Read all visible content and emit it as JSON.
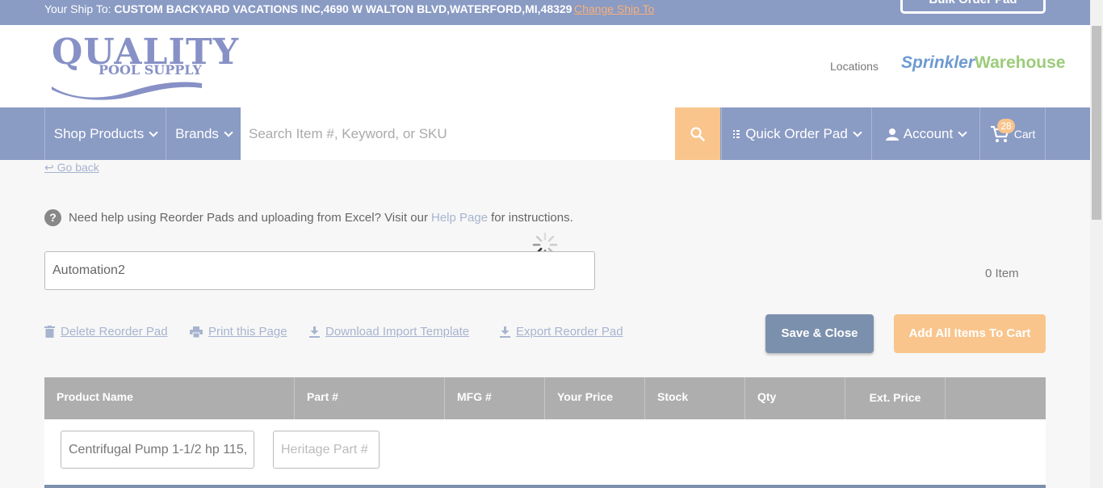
{
  "shipbar": {
    "prefix": "Your Ship To: ",
    "address": "CUSTOM BACKYARD VACATIONS INC,4690 W WALTON BLVD,WATERFORD,MI,48329",
    "change_label": "Change Ship To",
    "bulk_label": "Bulk Order Pad"
  },
  "header": {
    "logo_top": "QUALITY",
    "logo_bottom": "POOL SUPPLY",
    "locations_label": "Locations",
    "partner_a": "Sprinkler",
    "partner_b": "Warehouse"
  },
  "nav": {
    "shop_label": "Shop Products",
    "brands_label": "Brands",
    "search_placeholder": "Search Item #, Keyword, or SKU",
    "quick_order_label": "Quick Order Pad",
    "account_label": "Account",
    "cart_label": "Cart",
    "cart_count": "28"
  },
  "page": {
    "go_back": "Go back",
    "help_prefix": "Need help using Reorder Pads and uploading from Excel? Visit our",
    "help_link": "Help Page",
    "help_suffix": "for instructions.",
    "pad_name": "Automation2",
    "item_count": "0 Item"
  },
  "actions": {
    "delete": "Delete Reorder Pad",
    "print": "Print this Page",
    "download": "Download Import Template",
    "export": "Export Reorder Pad",
    "save_close": "Save & Close",
    "add_all": "Add All Items To Cart"
  },
  "table": {
    "headers": [
      "Product Name",
      "Part #",
      "MFG #",
      "Your Price",
      "Stock",
      "Qty",
      "Ext. Price"
    ],
    "row": {
      "product_value": "Centrifugal Pump 1-1/2 hp 115,",
      "part_placeholder": "Heritage Part #"
    }
  },
  "colors": {
    "brand_blue": "#8a9bc4",
    "accent_orange": "#f9c58d",
    "link_blue": "#a7b4cf",
    "table_header": "#aeaeae"
  }
}
